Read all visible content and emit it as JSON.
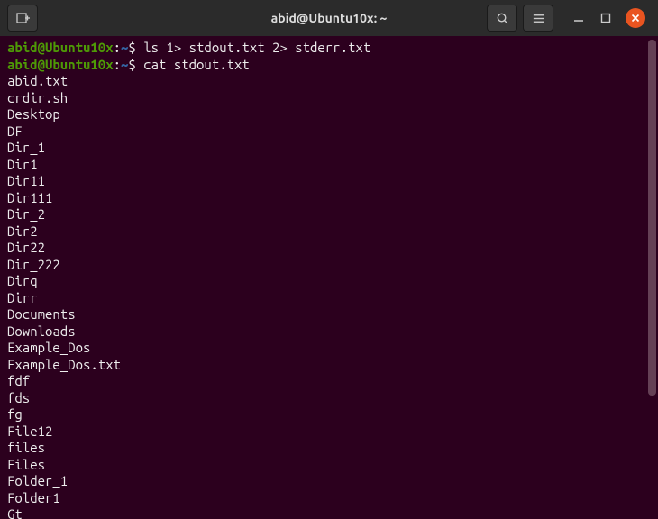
{
  "titlebar": {
    "title": "abid@Ubuntu10x: ~"
  },
  "terminal": {
    "prompts": [
      {
        "user_host": "abid@Ubuntu10x",
        "path": "~",
        "command": "ls 1> stdout.txt 2> stderr.txt"
      },
      {
        "user_host": "abid@Ubuntu10x",
        "path": "~",
        "command": "cat stdout.txt"
      }
    ],
    "output": [
      "abid.txt",
      "crdir.sh",
      "Desktop",
      "DF",
      "Dir_1",
      "Dir1",
      "Dir11",
      "Dir111",
      "Dir_2",
      "Dir2",
      "Dir22",
      "Dir_222",
      "Dirq",
      "Dirr",
      "Documents",
      "Downloads",
      "Example_Dos",
      "Example_Dos.txt",
      "fdf",
      "fds",
      "fg",
      "File12",
      "files",
      "Files",
      "Folder_1",
      "Folder1",
      "Gt"
    ]
  }
}
